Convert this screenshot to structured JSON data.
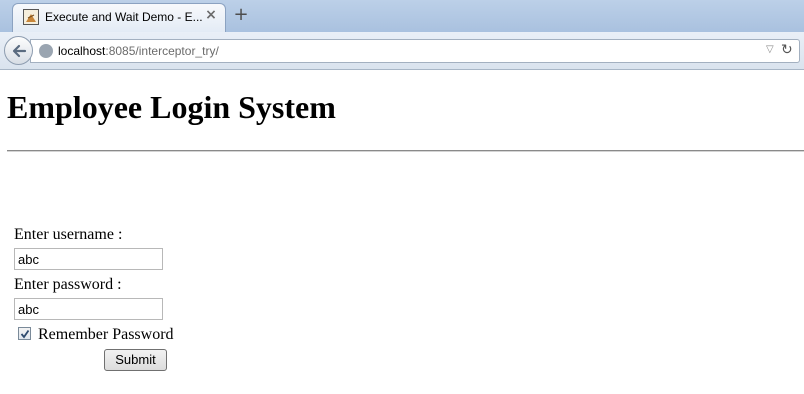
{
  "browser": {
    "tab_title": "Execute and Wait Demo - E...",
    "new_tab_label": "+",
    "url_host": "localhost",
    "url_rest": ":8085/interceptor_try/"
  },
  "page": {
    "title": "Employee Login System",
    "form": {
      "username_label": "Enter username :",
      "username_value": "abc",
      "password_label": "Enter password :",
      "password_value": "abc",
      "remember_label": "Remember Password",
      "remember_checked": true,
      "submit_label": "Submit"
    }
  },
  "icons": [
    "page-favicon-icon",
    "close-icon",
    "back-arrow-icon",
    "globe-icon",
    "dropdown-arrow-icon",
    "reload-icon",
    "checkmark-icon"
  ]
}
